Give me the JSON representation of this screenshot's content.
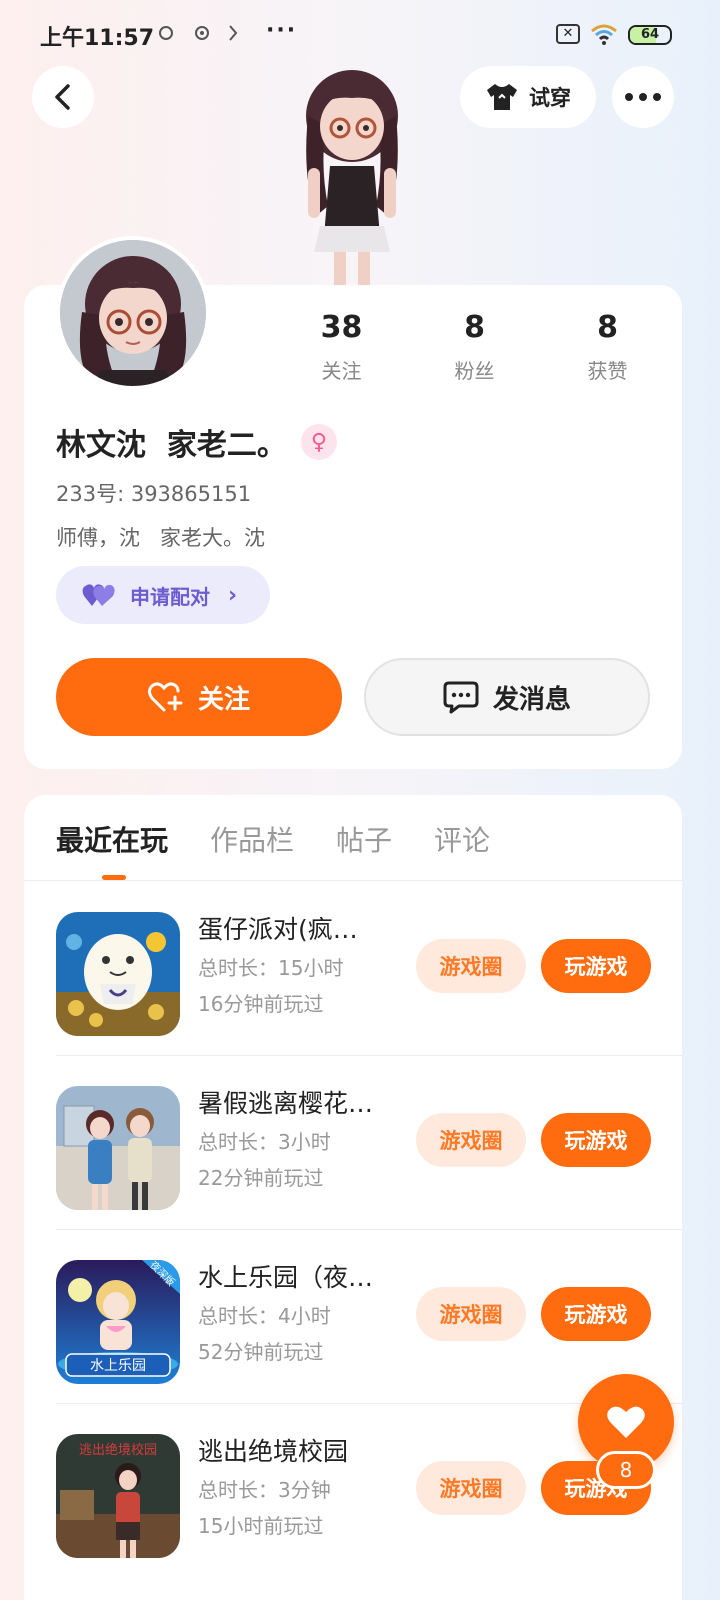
{
  "status_bar": {
    "time": "上午11:57",
    "more": "···",
    "battery": "64",
    "battery_level": 0.64
  },
  "header": {
    "try_on_label": "试穿"
  },
  "profile": {
    "stats": [
      {
        "value": "38",
        "label": "关注"
      },
      {
        "value": "8",
        "label": "粉丝"
      },
      {
        "value": "8",
        "label": "获赞"
      }
    ],
    "username": "林文沈  家老二。",
    "gender_symbol": "♀",
    "uid": "233号: 393865151",
    "bio": "师傅，沈   家老大。沈",
    "pair_label": "申请配对",
    "follow_label": "关注",
    "message_label": "发消息"
  },
  "tabs": [
    "最近在玩",
    "作品栏",
    "帖子",
    "评论"
  ],
  "games": [
    {
      "title": "蛋仔派对(疯…",
      "duration": "总时长：15小时",
      "last_played": "16分钟前玩过",
      "circle_label": "游戏圈",
      "play_label": "玩游戏"
    },
    {
      "title": "暑假逃离樱花…",
      "duration": "总时长：3小时",
      "last_played": "22分钟前玩过",
      "circle_label": "游戏圈",
      "play_label": "玩游戏"
    },
    {
      "title": "水上乐园（夜…",
      "duration": "总时长：4小时",
      "last_played": "52分钟前玩过",
      "circle_label": "游戏圈",
      "play_label": "玩游戏"
    },
    {
      "title": "逃出绝境校园",
      "duration": "总时长：3分钟",
      "last_played": "15小时前玩过",
      "circle_label": "游戏圈",
      "play_label": "玩游戏"
    }
  ],
  "game_icon_text": {
    "badge": "夜深版",
    "park": "水上乐园",
    "school": "逃出绝境校园"
  },
  "fab": {
    "count": "8"
  },
  "colors": {
    "accent": "#ff6b0f",
    "accent_light": "#ffe9dc",
    "pair": "#6d5bd0"
  }
}
